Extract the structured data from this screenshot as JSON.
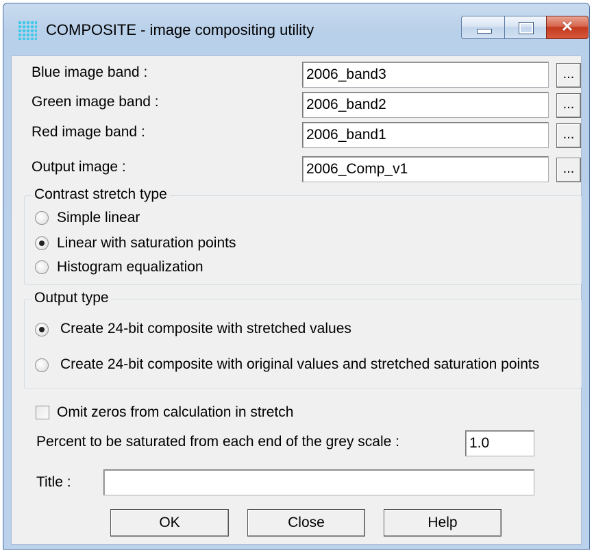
{
  "window": {
    "title": "COMPOSITE - image compositing utility",
    "close_glyph": "✕"
  },
  "bands": {
    "blue": {
      "label": "Blue image band :",
      "value": "2006_band3"
    },
    "green": {
      "label": "Green image band :",
      "value": "2006_band2"
    },
    "red": {
      "label": "Red image band :",
      "value": "2006_band1"
    },
    "output": {
      "label": "Output image :",
      "value": "2006_Comp_v1"
    },
    "browse_label": "..."
  },
  "stretch": {
    "legend": "Contrast stretch type",
    "options": [
      "Simple linear",
      "Linear with saturation points",
      "Histogram equalization"
    ],
    "selected": 1
  },
  "output_type": {
    "legend": "Output type",
    "options": [
      "Create 24-bit composite with stretched values",
      "Create 24-bit composite with original values and stretched saturation points"
    ],
    "selected": 0
  },
  "omit_zeros": {
    "label": "Omit zeros from calculation in stretch",
    "checked": false
  },
  "percent": {
    "label": "Percent to be saturated from each end of the grey scale :",
    "value": "1.0"
  },
  "title_field": {
    "label": "Title :",
    "value": ""
  },
  "buttons": {
    "ok": "OK",
    "close": "Close",
    "help": "Help"
  }
}
